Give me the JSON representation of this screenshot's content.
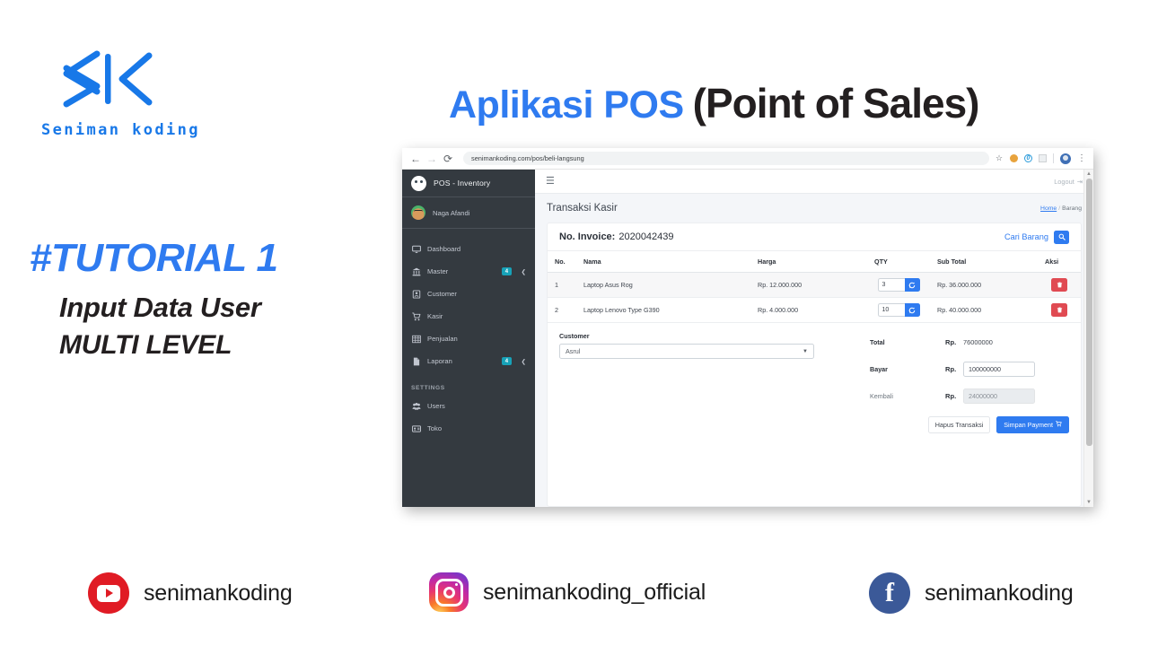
{
  "brand": {
    "logo_mark": "sk-logo-icon",
    "wordmark": "Seniman koding"
  },
  "title": {
    "highlight": "Aplikasi POS",
    "rest": "(Point of Sales)"
  },
  "tutorial": {
    "tag": "#TUTORIAL 1",
    "line1": "Input Data User",
    "line2": "MULTI LEVEL"
  },
  "browser": {
    "url": "senimankoding.com/pos/beli-langsung",
    "back_icon": "back-arrow-icon",
    "forward_icon": "forward-arrow-icon",
    "reload_icon": "reload-icon",
    "bookmark_icon": "star-icon",
    "menu_icon": "kebab-menu-icon",
    "profile_icon": "profile-avatar-icon",
    "extension_1": "orange-extension-icon",
    "extension_2": "blue-extension-icon",
    "extension_3": "grey-extension-icon"
  },
  "sidebar": {
    "brand_label": "POS - Inventory",
    "brand_icon": "pos-logo-icon",
    "user": {
      "name": "Naga Afandi",
      "avatar_icon": "user-avatar-icon"
    },
    "items": [
      {
        "label": "Dashboard",
        "icon": "desktop-icon",
        "badge": "",
        "caret": false
      },
      {
        "label": "Master",
        "icon": "bank-icon",
        "badge": "4",
        "caret": true
      },
      {
        "label": "Customer",
        "icon": "id-card-icon",
        "badge": "",
        "caret": false
      },
      {
        "label": "Kasir",
        "icon": "cart-icon",
        "badge": "",
        "caret": false
      },
      {
        "label": "Penjualan",
        "icon": "table-icon",
        "badge": "",
        "caret": false
      },
      {
        "label": "Laporan",
        "icon": "file-icon",
        "badge": "4",
        "caret": true
      }
    ],
    "settings_heading": "SETTINGS",
    "settings_items": [
      {
        "label": "Users",
        "icon": "users-icon"
      },
      {
        "label": "Toko",
        "icon": "store-card-icon"
      }
    ],
    "badge_color": "#17a2b8",
    "bg_color": "#343a40"
  },
  "topbar": {
    "menu_icon": "hamburger-icon",
    "logout_label": "Logout",
    "logout_icon": "sign-out-icon"
  },
  "page": {
    "title": "Transaksi Kasir",
    "breadcrumb_home": "Home",
    "breadcrumb_sep": "/",
    "breadcrumb_current": "Barang"
  },
  "invoice": {
    "label": "No. Invoice:",
    "number": "2020042439",
    "search_label": "Cari Barang",
    "search_icon": "search-icon"
  },
  "table": {
    "columns": [
      "No.",
      "Nama",
      "Harga",
      "QTY",
      "Sub Total",
      "Aksi"
    ],
    "rows": [
      {
        "no": "1",
        "nama": "Laptop Asus Rog",
        "harga": "Rp. 12.000.000",
        "qty": "3",
        "qty_button_icon": "refresh-icon",
        "subtotal": "Rp. 36.000.000",
        "delete_icon": "trash-icon"
      },
      {
        "no": "2",
        "nama": "Laptop Lenovo Type G390",
        "harga": "Rp. 4.000.000",
        "qty": "10",
        "qty_button_icon": "refresh-icon",
        "subtotal": "Rp. 40.000.000",
        "delete_icon": "trash-icon"
      }
    ]
  },
  "payment": {
    "customer_label": "Customer",
    "customer_value": "Asrul",
    "customer_caret_icon": "chevron-down-icon",
    "total_label": "Total",
    "total_rp": "Rp.",
    "total_value": "76000000",
    "bayar_label": "Bayar",
    "bayar_rp": "Rp.",
    "bayar_value": "100000000",
    "kembali_label": "Kembali",
    "kembali_rp": "Rp.",
    "kembali_value": "24000000",
    "delete_transaction_label": "Hapus Transaksi",
    "save_payment_label": "Simpan Payment",
    "save_payment_icon": "cart-icon",
    "primary_color": "#2f7bf0"
  },
  "socials": [
    {
      "platform": "youtube",
      "icon": "youtube-icon",
      "handle": "senimankoding"
    },
    {
      "platform": "instagram",
      "icon": "instagram-icon",
      "handle": "senimankoding_official"
    },
    {
      "platform": "facebook",
      "icon": "facebook-icon",
      "handle": "senimankoding"
    }
  ]
}
